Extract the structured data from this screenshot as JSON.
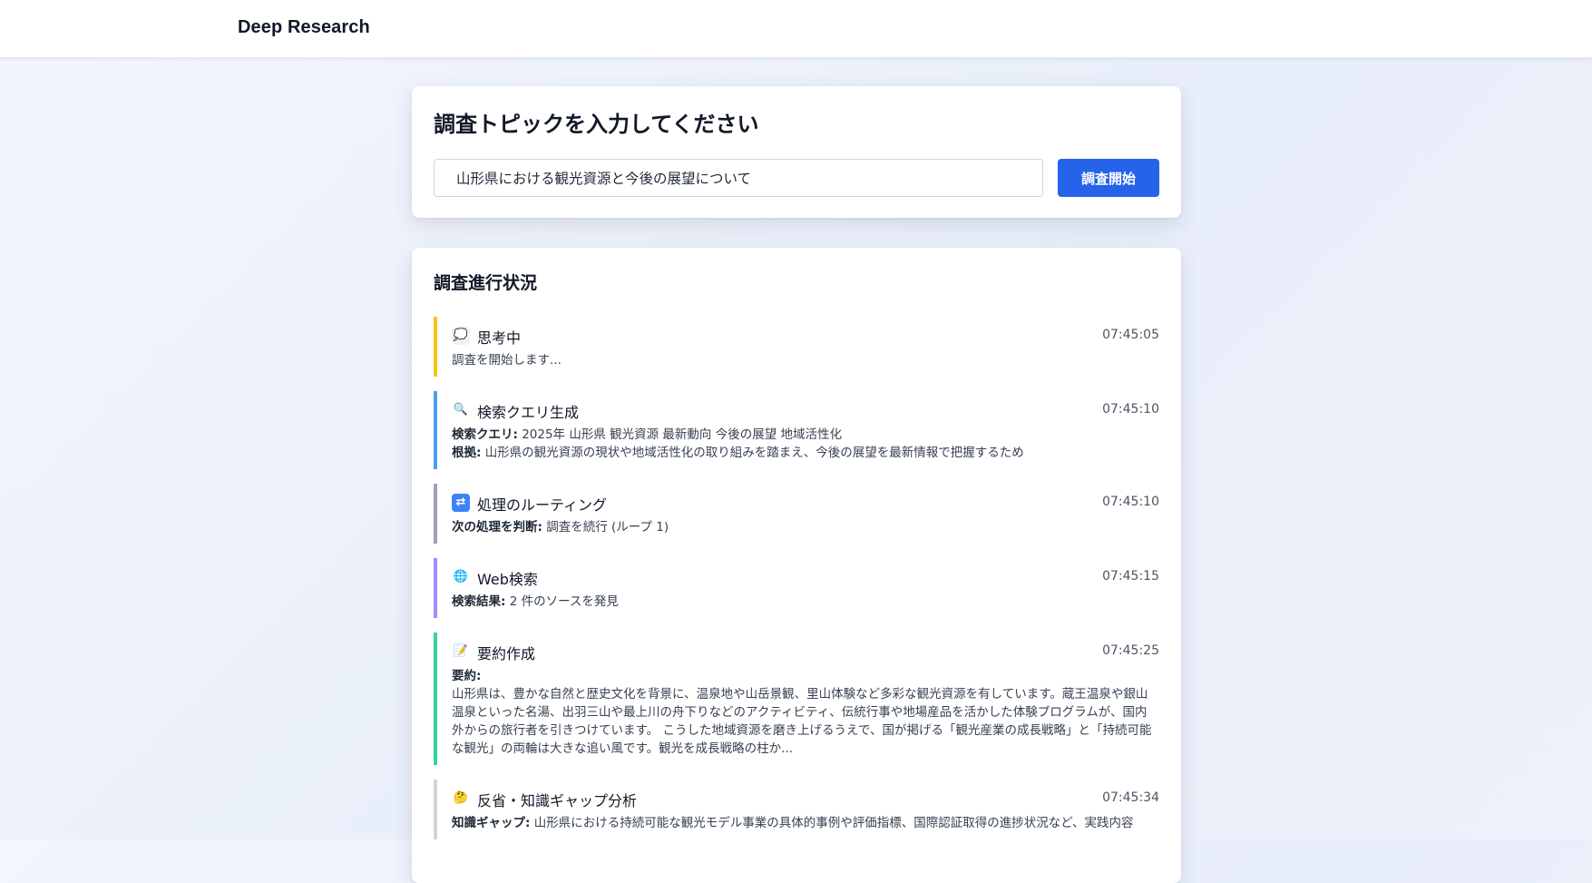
{
  "app": {
    "brand": "Deep Research"
  },
  "topic": {
    "title": "調査トピックを入力してください",
    "input_value": "山形県における観光資源と今後の展望について",
    "start_button": "調査開始"
  },
  "progress": {
    "title": "調査進行状況",
    "steps": [
      {
        "icon": "thought-bubble-icon",
        "glyph": "💭",
        "color": "#f5c518",
        "title": "思考中",
        "time": "07:45:05",
        "text": "調査を開始します..."
      },
      {
        "icon": "magnifier-icon",
        "glyph": "🔍",
        "color": "#4b9fe8",
        "title": "検索クエリ生成",
        "time": "07:45:10",
        "query_label": "検索クエリ:",
        "query_text": "2025年 山形県 観光資源 最新動向 今後の展望 地域活性化",
        "basis_label": "根拠:",
        "basis_text": "山形県の観光資源の現状や地域活性化の取り組みを踏まえ、今後の展望を最新情報で把握するため"
      },
      {
        "icon": "shuffle-icon",
        "glyph": "⇄",
        "color": "#9ca3af",
        "title": "処理のルーティング",
        "time": "07:45:10",
        "label": "次の処理を判断:",
        "text": "調査を続行 (ループ 1)"
      },
      {
        "icon": "globe-icon",
        "glyph": "🌐",
        "color": "#a78bfa",
        "title": "Web検索",
        "time": "07:45:15",
        "label": "検索結果:",
        "text": "2 件のソースを発見"
      },
      {
        "icon": "memo-icon",
        "glyph": "📝",
        "color": "#34d399",
        "title": "要約作成",
        "time": "07:45:25",
        "label": "要約:",
        "text": "山形県は、豊かな自然と歴史文化を背景に、温泉地や山岳景観、里山体験など多彩な観光資源を有しています。蔵王温泉や銀山温泉といった名湯、出羽三山や最上川の舟下りなどのアクティビティ、伝統行事や地場産品を活かした体験プログラムが、国内外からの旅行者を引きつけています。 こうした地域資源を磨き上げるうえで、国が掲げる「観光産業の成長戦略」と「持続可能な観光」の両輪は大きな追い風です。観光を成長戦略の柱か..."
      },
      {
        "icon": "thinking-face-icon",
        "glyph": "🤔",
        "color": "#d1d5db",
        "title": "反省・知識ギャップ分析",
        "time": "07:45:34",
        "label": "知識ギャップ:",
        "text": "山形県における持続可能な観光モデル事業の具体的事例や評価指標、国際認証取得の進捗状況など、実践内容"
      }
    ]
  }
}
